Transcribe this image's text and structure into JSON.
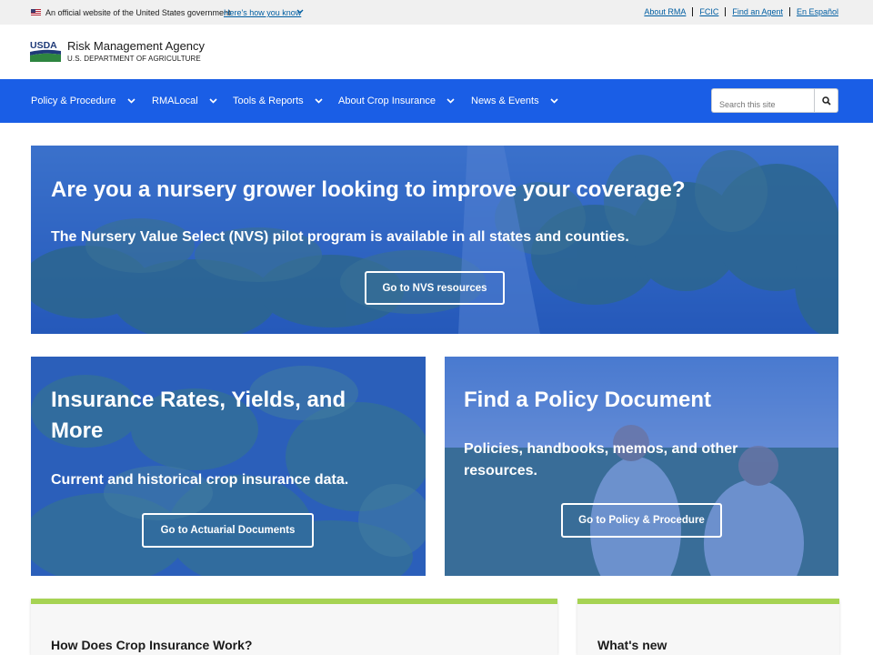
{
  "gov_banner": {
    "official_text": "An official website of the United States government",
    "how_know": "Here's how you know",
    "links": [
      "About RMA",
      "FCIC",
      "Find an Agent",
      "En Español"
    ]
  },
  "header": {
    "logo_text": "USDA",
    "agency": "Risk Management Agency",
    "department": "U.S. DEPARTMENT OF AGRICULTURE"
  },
  "nav": {
    "items": [
      "Policy & Procedure",
      "RMALocal",
      "Tools & Reports",
      "About Crop Insurance",
      "News & Events"
    ],
    "search_placeholder": "Search this site"
  },
  "hero": {
    "title": "Are you a nursery grower looking to improve your coverage?",
    "subtitle": "The Nursery Value Select (NVS) pilot program is available in all states and counties.",
    "button": "Go to NVS resources"
  },
  "cards": [
    {
      "title_line1": "Insurance Rates, Yields, and",
      "title_line2": "More",
      "subtitle": "Current and historical crop insurance data.",
      "button": "Go to Actuarial Documents"
    },
    {
      "title": "Find a Policy Document",
      "subtitle_line1": "Policies, handbooks, memos, and other",
      "subtitle_line2": "resources.",
      "button": "Go to Policy & Procedure"
    }
  ],
  "panels": [
    "How Does Crop Insurance Work?",
    "What's new"
  ],
  "colors": {
    "nav_blue": "#1a5ee6",
    "overlay_blue": "#1e55c8",
    "panel_accent": "#a6d353",
    "link_blue": "#005ea2"
  }
}
